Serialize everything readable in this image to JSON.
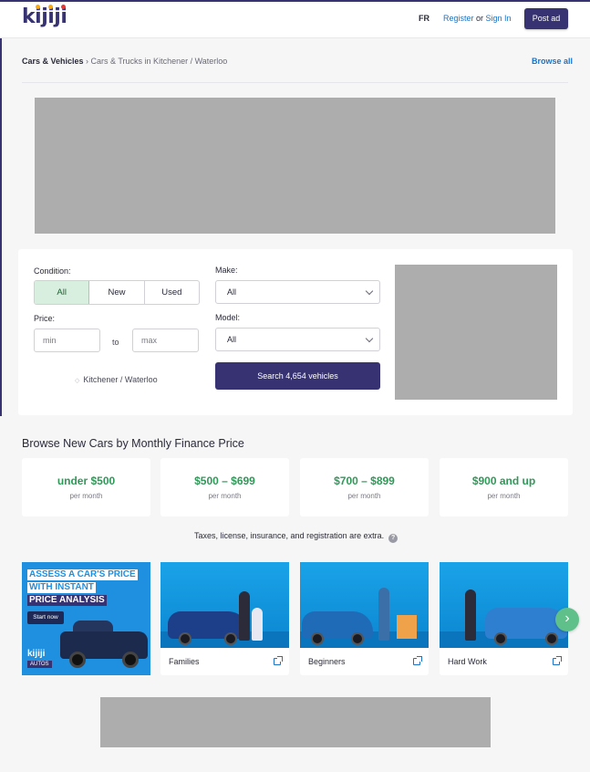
{
  "header": {
    "logo": {
      "letters": [
        "k",
        "i",
        "j",
        "i",
        "j",
        "i"
      ],
      "colors": [
        "#373373",
        "#f8aa17",
        "#4b8ee8",
        "#f8aa17",
        "#373373",
        "#e53935"
      ]
    },
    "lang": "FR",
    "register": "Register",
    "or": " or ",
    "signin": "Sign In",
    "post_ad": "Post ad"
  },
  "breadcrumb": {
    "root": "Cars & Vehicles",
    "separator": " › ",
    "current": "Cars & Trucks in Kitchener / Waterloo"
  },
  "browse_all": "Browse all",
  "search": {
    "condition_label": "Condition:",
    "conditions": [
      "All",
      "New",
      "Used"
    ],
    "condition_selected": "All",
    "price_label": "Price:",
    "min_placeholder": "min",
    "max_placeholder": "max",
    "to": "to",
    "location": "Kitchener / Waterloo",
    "make_label": "Make:",
    "make_value": "All",
    "model_label": "Model:",
    "model_value": "All",
    "search_button": "Search 4,654 vehicles"
  },
  "finance": {
    "title": "Browse New Cars by Monthly Finance Price",
    "cards": [
      {
        "price": "under $500",
        "period": "per month"
      },
      {
        "price": "$500 – $699",
        "period": "per month"
      },
      {
        "price": "$700 – $899",
        "period": "per month"
      },
      {
        "price": "$900 and up",
        "period": "per month"
      }
    ],
    "note": "Taxes, license, insurance, and registration are extra.",
    "help_icon": "?"
  },
  "promo": {
    "line1": "ASSESS A CAR'S PRICE",
    "line2": "WITH INSTANT",
    "line3": "PRICE ANALYSIS",
    "cta": "Start now",
    "brand": "kijiji",
    "brand_sub": "AUTOS"
  },
  "categories": [
    {
      "label": "Families",
      "car_color": "#1d3f8a"
    },
    {
      "label": "Beginners",
      "car_color": "#1f6bb8"
    },
    {
      "label": "Hard Work",
      "car_color": "#2f7fd0"
    }
  ],
  "next_icon": "›",
  "colors": {
    "accent": "#373373",
    "link": "#1a73c8",
    "price_green": "#2f9a58",
    "ad_grey": "#aeadae"
  }
}
